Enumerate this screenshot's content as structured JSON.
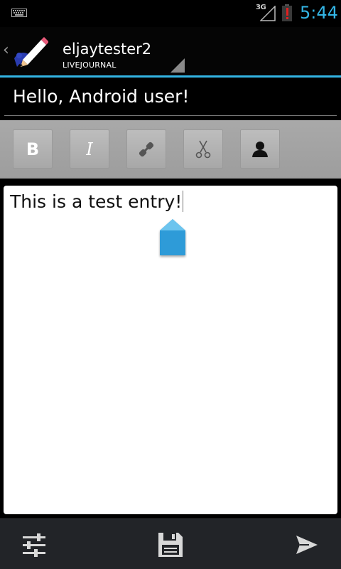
{
  "status_bar": {
    "network_type": "3G",
    "time": "5:44",
    "icons": [
      "keyboard-icon",
      "signal-icon",
      "battery-alert-icon"
    ]
  },
  "action_bar": {
    "account_name": "eljaytester2",
    "account_type": "LIVEJOURNAL",
    "icons": [
      "up-caret-icon",
      "app-pencil-logo",
      "spinner-corner-icon"
    ]
  },
  "subject": {
    "value": "Hello, Android user!"
  },
  "toolbar": {
    "buttons": [
      {
        "name": "bold",
        "glyph": "B"
      },
      {
        "name": "italic",
        "glyph": "I"
      },
      {
        "name": "link",
        "icon": "link-icon"
      },
      {
        "name": "cut",
        "icon": "scissors-icon"
      },
      {
        "name": "user",
        "icon": "user-icon"
      }
    ]
  },
  "editor": {
    "body_text": "This is a test entry!"
  },
  "bottom_bar": {
    "buttons": [
      {
        "name": "settings",
        "icon": "sliders-icon"
      },
      {
        "name": "save",
        "icon": "floppy-icon"
      },
      {
        "name": "send",
        "icon": "send-icon"
      }
    ]
  },
  "colors": {
    "accent": "#33b5e5",
    "toolbar_bg": "#a3a3a3",
    "bottom_bar_bg": "#222428",
    "handle": "#2f9bd8"
  }
}
